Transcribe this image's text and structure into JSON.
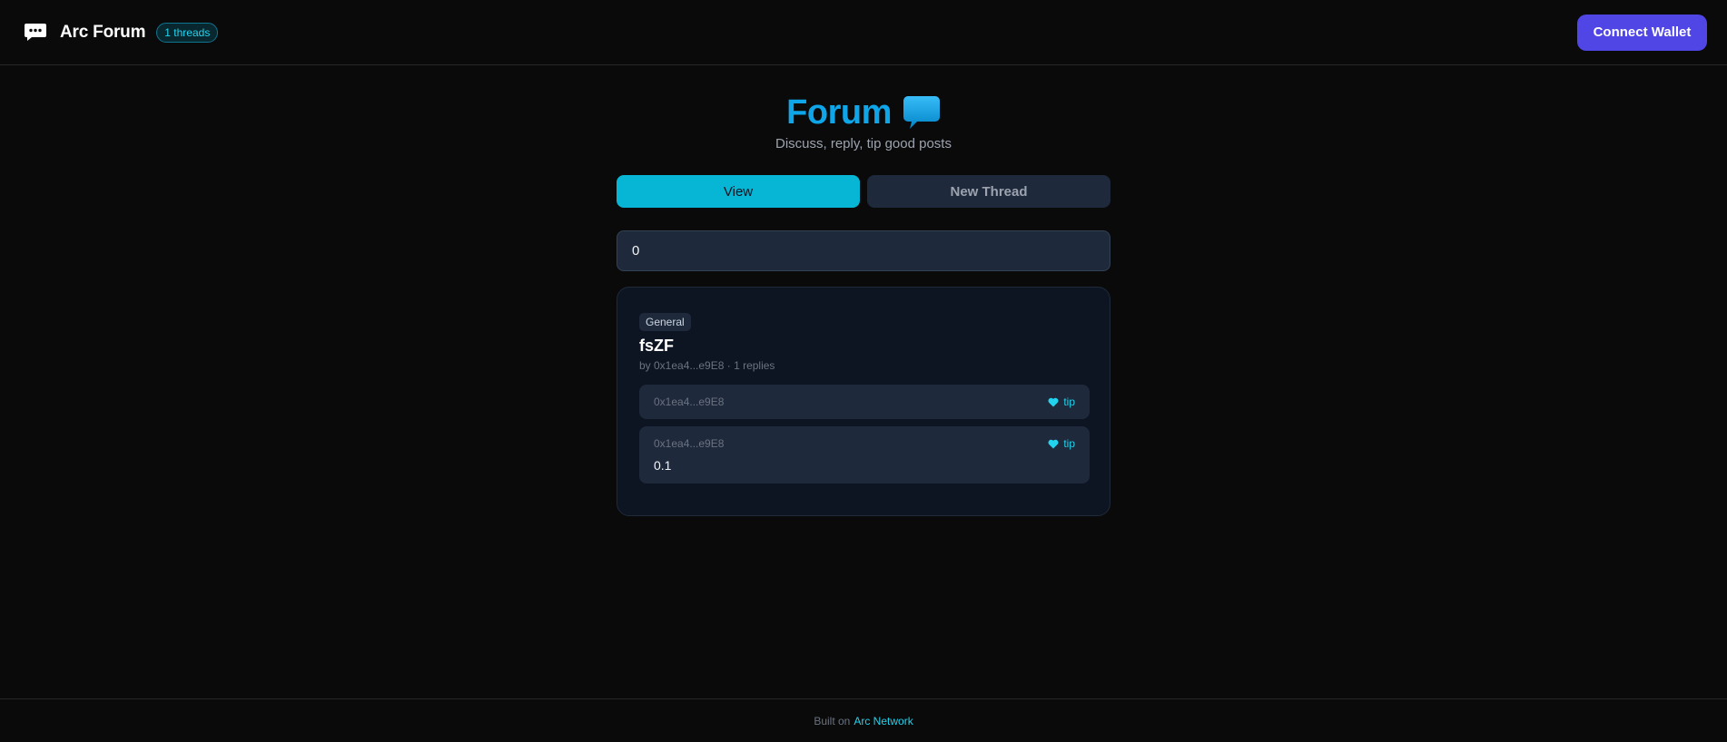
{
  "header": {
    "app_title": "Arc Forum",
    "thread_count_badge": "1 threads",
    "connect_wallet_label": "Connect Wallet"
  },
  "hero": {
    "title": "Forum",
    "subtitle": "Discuss, reply, tip good posts"
  },
  "tabs": [
    {
      "label": "View",
      "active": true
    },
    {
      "label": "New Thread",
      "active": false
    }
  ],
  "thread_id_input": {
    "value": "0"
  },
  "thread": {
    "category": "General",
    "title": "fsZF",
    "meta": "by 0x1ea4...e9E8 · 1 replies",
    "posts": [
      {
        "author": "0x1ea4...e9E8",
        "tip_label": "tip",
        "body": ""
      },
      {
        "author": "0x1ea4...e9E8",
        "tip_label": "tip",
        "body": "0.1"
      }
    ]
  },
  "footer": {
    "text": "Built on",
    "link_label": "Arc Network"
  },
  "colors": {
    "background": "#0a0a0a",
    "accent_cyan": "#06b6d4",
    "title_blue": "#0ea5e9",
    "wallet_indigo": "#4f46e5",
    "card": "#0d1422",
    "panel": "#1e293b"
  },
  "icons": {
    "brand": "chat-bubble-icon",
    "hero": "speech-balloon-icon",
    "tip": "heart-icon"
  }
}
